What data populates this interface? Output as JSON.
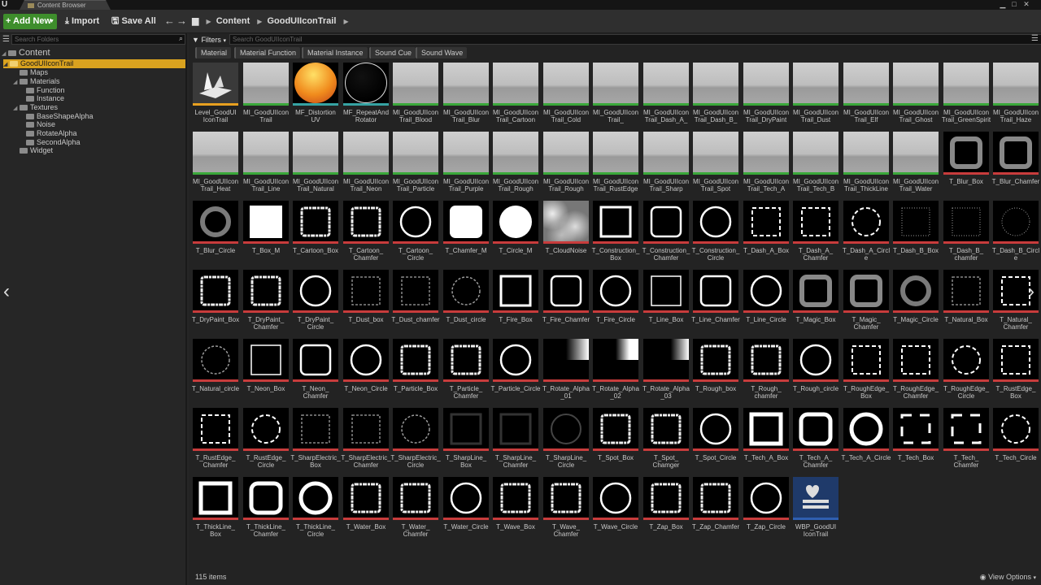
{
  "window": {
    "tab_title": "Content Browser",
    "logo": "U"
  },
  "toolbar": {
    "add_new": "Add New",
    "import": "Import",
    "save_all": "Save All"
  },
  "path": [
    "Content",
    "GoodUIIconTrail"
  ],
  "sidebar": {
    "search_placeholder": "Search Folders",
    "root": "Content",
    "items": [
      {
        "label": "GoodUIIconTrail",
        "selected": true
      },
      {
        "label": "Maps"
      },
      {
        "label": "Materials"
      },
      {
        "label": "Function"
      },
      {
        "label": "Instance"
      },
      {
        "label": "Textures"
      },
      {
        "label": "BaseShapeAlpha"
      },
      {
        "label": "Noise"
      },
      {
        "label": "RotateAlpha"
      },
      {
        "label": "SecondAlpha"
      },
      {
        "label": "Widget"
      }
    ]
  },
  "filters": {
    "label": "Filters",
    "search_placeholder": "Search GoodUIIconTrail",
    "chips": [
      "Material",
      "Material Function",
      "Material Instance",
      "Sound Cue",
      "Sound Wave"
    ]
  },
  "colors": {
    "material_instance": "#3aa83a",
    "texture": "#c83c3c",
    "material_function": "#36a3a3",
    "level": "#e8a020",
    "widget": "#2f5fb0"
  },
  "assets": [
    [
      "Level_GoodUI IconTrail",
      "level",
      "level"
    ],
    [
      "MI_GoodUIIcon Trail",
      "mi",
      "mat"
    ],
    [
      "MF_Distortion UV",
      "mf",
      "orange"
    ],
    [
      "MF_RepeatAnd Rotator",
      "mf",
      "black"
    ],
    [
      "MI_GoodUIIcon Trail_Blood",
      "mi",
      "mat"
    ],
    [
      "MI_GoodUIIcon Trail_Blur",
      "mi",
      "mat"
    ],
    [
      "MI_GoodUIIcon Trail_Cartoon",
      "mi",
      "mat"
    ],
    [
      "MI_GoodUIIcon Trail_Cold",
      "mi",
      "mat"
    ],
    [
      "MI_GoodUIIcon Trail_ Construction",
      "mi",
      "mat"
    ],
    [
      "MI_GoodUIIcon Trail_Dash_A_ Line",
      "mi",
      "mat"
    ],
    [
      "MI_GoodUIIcon Trail_Dash_B_ Line",
      "mi",
      "mat"
    ],
    [
      "MI_GoodUIIcon Trail_DryPaint",
      "mi",
      "mat"
    ],
    [
      "MI_GoodUIIcon Trail_Dust",
      "mi",
      "mat"
    ],
    [
      "MI_GoodUIIcon Trail_Elf",
      "mi",
      "mat"
    ],
    [
      "MI_GoodUIIcon Trail_Ghost",
      "mi",
      "mat"
    ],
    [
      "MI_GoodUIIcon Trail_GreenSpirit",
      "mi",
      "mat"
    ],
    [
      "MI_GoodUIIcon Trail_Haze",
      "mi",
      "mat"
    ],
    [
      "MI_GoodUIIcon Trail_Heat",
      "mi",
      "mat"
    ],
    [
      "MI_GoodUIIcon Trail_Line",
      "mi",
      "mat"
    ],
    [
      "MI_GoodUIIcon Trail_Natural",
      "mi",
      "mat"
    ],
    [
      "MI_GoodUIIcon Trail_Neon",
      "mi",
      "mat"
    ],
    [
      "MI_GoodUIIcon Trail_Particle",
      "mi",
      "mat"
    ],
    [
      "MI_GoodUIIcon Trail_Purple Electric",
      "mi",
      "mat"
    ],
    [
      "MI_GoodUIIcon Trail_Rough",
      "mi",
      "mat"
    ],
    [
      "MI_GoodUIIcon Trail_Rough Edge",
      "mi",
      "mat"
    ],
    [
      "MI_GoodUIIcon Trail_RustEdge",
      "mi",
      "mat"
    ],
    [
      "MI_GoodUIIcon Trail_Sharp Electric",
      "mi",
      "mat"
    ],
    [
      "MI_GoodUIIcon Trail_Spot",
      "mi",
      "mat"
    ],
    [
      "MI_GoodUIIcon Trail_Tech_A",
      "mi",
      "mat"
    ],
    [
      "MI_GoodUIIcon Trail_Tech_B",
      "mi",
      "mat"
    ],
    [
      "MI_GoodUIIcon Trail_ThickLine",
      "mi",
      "mat"
    ],
    [
      "MI_GoodUIIcon Trail_Water",
      "mi",
      "mat"
    ],
    [
      "T_Blur_Box",
      "tex",
      "blurbox"
    ],
    [
      "T_Blur_Chamfer",
      "tex",
      "blurbox"
    ],
    [
      "T_Blur_Circle",
      "tex",
      "blurcircle"
    ],
    [
      "T_Box_M",
      "tex",
      "solidbox"
    ],
    [
      "T_Cartoon_Box",
      "tex",
      "roughbox"
    ],
    [
      "T_Cartoon_ Chamfer",
      "tex",
      "roughbox"
    ],
    [
      "T_Cartoon_ Circle",
      "tex",
      "circle"
    ],
    [
      "T_Chamfer_M",
      "tex",
      "solidchamfer"
    ],
    [
      "T_Circle_M",
      "tex",
      "solidcircle"
    ],
    [
      "T_CloudNoise",
      "tex",
      "noise"
    ],
    [
      "T_Construction_ Box",
      "tex",
      "box"
    ],
    [
      "T_Construction_ Chamfer",
      "tex",
      "chamfer"
    ],
    [
      "T_Construction_ Circle",
      "tex",
      "circle"
    ],
    [
      "T_Dash_A_Box",
      "tex",
      "dashbox"
    ],
    [
      "T_Dash_A_ Chamfer",
      "tex",
      "dashbox"
    ],
    [
      "T_Dash_A_Circle",
      "tex",
      "dashcircle"
    ],
    [
      "T_Dash_B_Box",
      "tex",
      "dotbox"
    ],
    [
      "T_Dash_B_ chamfer",
      "tex",
      "dotbox"
    ],
    [
      "T_Dash_B_Circle",
      "tex",
      "dotcircle"
    ],
    [
      "T_DryPaint_Box",
      "tex",
      "roughbox"
    ],
    [
      "T_DryPaint_ Chamfer",
      "tex",
      "roughbox"
    ],
    [
      "T_DryPaint_ Circle",
      "tex",
      "circle"
    ],
    [
      "T_Dust_box",
      "tex",
      "faintbox"
    ],
    [
      "T_Dust_chamfer",
      "tex",
      "faintbox"
    ],
    [
      "T_Dust_circle",
      "tex",
      "faintcircle"
    ],
    [
      "T_Fire_Box",
      "tex",
      "box"
    ],
    [
      "T_Fire_Chamfer",
      "tex",
      "chamfer"
    ],
    [
      "T_Fire_Circle",
      "tex",
      "circle"
    ],
    [
      "T_Line_Box",
      "tex",
      "thinbox"
    ],
    [
      "T_Line_Chamfer",
      "tex",
      "chamfer"
    ],
    [
      "T_Line_Circle",
      "tex",
      "circle"
    ],
    [
      "T_Magic_Box",
      "tex",
      "blurbox"
    ],
    [
      "T_Magic_ Chamfer",
      "tex",
      "blurbox"
    ],
    [
      "T_Magic_Circle",
      "tex",
      "blurcircle"
    ],
    [
      "T_Natural_Box",
      "tex",
      "faintbox"
    ],
    [
      "T_Natural_ Chamfer",
      "tex",
      "dashbox"
    ],
    [
      "T_Natural_circle",
      "tex",
      "faintcircle"
    ],
    [
      "T_Neon_Box",
      "tex",
      "thinbox"
    ],
    [
      "T_Neon_ Chamfer",
      "tex",
      "chamfer"
    ],
    [
      "T_Neon_Circle",
      "tex",
      "circle"
    ],
    [
      "T_Particle_Box",
      "tex",
      "roughbox"
    ],
    [
      "T_Particle_ Chamfer",
      "tex",
      "roughbox"
    ],
    [
      "T_Particle_Circle",
      "tex",
      "circle"
    ],
    [
      "T_Rotate_Alpha _01",
      "tex",
      "grad1"
    ],
    [
      "T_Rotate_Alpha _02",
      "tex",
      "grad2"
    ],
    [
      "T_Rotate_Alpha _03",
      "tex",
      "grad3"
    ],
    [
      "T_Rough_box",
      "tex",
      "roughbox"
    ],
    [
      "T_Rough_ chamfer",
      "tex",
      "roughbox"
    ],
    [
      "T_Rough_circle",
      "tex",
      "circle"
    ],
    [
      "T_RoughEdge_ Box",
      "tex",
      "dashbox"
    ],
    [
      "T_RoughEdge_ Chamfer",
      "tex",
      "dashbox"
    ],
    [
      "T_RoughEdge_ Circle",
      "tex",
      "dashcircle"
    ],
    [
      "T_RustEdge_ Box",
      "tex",
      "dashbox"
    ],
    [
      "T_RustEdge_ Chamfer",
      "tex",
      "dashbox"
    ],
    [
      "T_RustEdge_ Circle",
      "tex",
      "dashcircle"
    ],
    [
      "T_SharpElectric_ Box",
      "tex",
      "faintbox"
    ],
    [
      "T_SharpElectric_ Chamfer",
      "tex",
      "faintbox"
    ],
    [
      "T_SharpElectric_ Circle",
      "tex",
      "faintcircle"
    ],
    [
      "T_SharpLine_ Box",
      "tex",
      "glowbox"
    ],
    [
      "T_SharpLine_ Chamfer",
      "tex",
      "glowbox"
    ],
    [
      "T_SharpLine_ Circle",
      "tex",
      "glowcircle"
    ],
    [
      "T_Spot_Box",
      "tex",
      "roughbox"
    ],
    [
      "T_Spot_ Chamger",
      "tex",
      "roughbox"
    ],
    [
      "T_Spot_Circle",
      "tex",
      "circle"
    ],
    [
      "T_Tech_A_Box",
      "tex",
      "thickbox"
    ],
    [
      "T_Tech_A_ Chamfer",
      "tex",
      "thickchamfer"
    ],
    [
      "T_Tech_A_Circle",
      "tex",
      "thickcircle"
    ],
    [
      "T_Tech_Box",
      "tex",
      "cornerbox"
    ],
    [
      "T_Tech_ Chamfer",
      "tex",
      "cornerbox"
    ],
    [
      "T_Tech_Circle",
      "tex",
      "dashcircle"
    ],
    [
      "T_ThickLine_ Box",
      "tex",
      "thickbox"
    ],
    [
      "T_ThickLine_ Chamfer",
      "tex",
      "thickchamfer"
    ],
    [
      "T_ThickLine_ Circle",
      "tex",
      "thickcircle"
    ],
    [
      "T_Water_Box",
      "tex",
      "roughbox"
    ],
    [
      "T_Water_ Chamfer",
      "tex",
      "roughbox"
    ],
    [
      "T_Water_Circle",
      "tex",
      "circle"
    ],
    [
      "T_Wave_Box",
      "tex",
      "roughbox"
    ],
    [
      "T_Wave_ Chamfer",
      "tex",
      "roughbox"
    ],
    [
      "T_Wave_Circle",
      "tex",
      "circle"
    ],
    [
      "T_Zap_Box",
      "tex",
      "roughbox"
    ],
    [
      "T_Zap_Chamfer",
      "tex",
      "roughbox"
    ],
    [
      "T_Zap_Circle",
      "tex",
      "circle"
    ],
    [
      "WBP_GoodUI IconTrail",
      "widget",
      "widget"
    ]
  ],
  "status": {
    "count": "115 items",
    "view_options": "View Options"
  }
}
